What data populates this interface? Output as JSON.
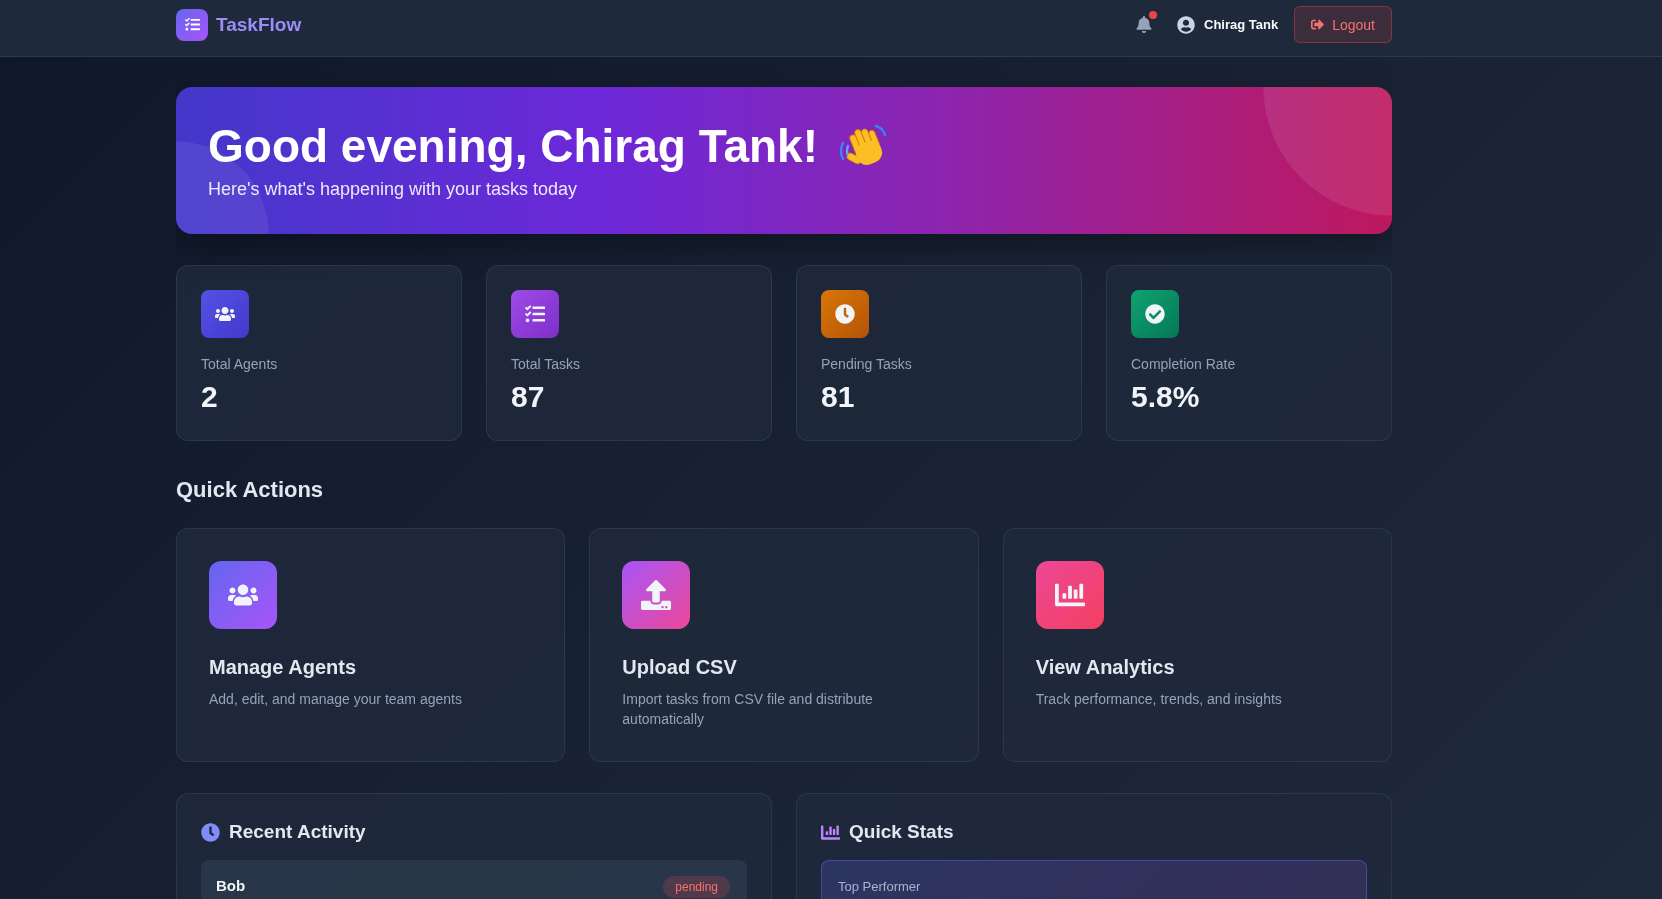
{
  "header": {
    "brand": "TaskFlow",
    "unread_notifications": true,
    "user_name": "Chirag Tank",
    "logout_label": "Logout"
  },
  "hero": {
    "greeting": "Good evening, Chirag Tank!",
    "subtitle": "Here's what's happening with your tasks today"
  },
  "stats": [
    {
      "kind": "agents",
      "label": "Total Agents",
      "value": "2"
    },
    {
      "kind": "tasks",
      "label": "Total Tasks",
      "value": "87"
    },
    {
      "kind": "pending",
      "label": "Pending Tasks",
      "value": "81"
    },
    {
      "kind": "completion",
      "label": "Completion Rate",
      "value": "5.8%"
    }
  ],
  "quick_actions": {
    "title": "Quick Actions",
    "items": [
      {
        "kind": "agents",
        "title": "Manage Agents",
        "description": "Add, edit, and manage your team agents"
      },
      {
        "kind": "upload",
        "title": "Upload CSV",
        "description": "Import tasks from CSV file and distribute automatically"
      },
      {
        "kind": "analytics",
        "title": "View Analytics",
        "description": "Track performance, trends, and insights"
      }
    ]
  },
  "recent_activity": {
    "title": "Recent Activity",
    "items": [
      {
        "name": "Bob",
        "status": "pending"
      }
    ]
  },
  "quick_stats": {
    "title": "Quick Stats",
    "items": [
      {
        "label": "Top Performer"
      }
    ]
  }
}
